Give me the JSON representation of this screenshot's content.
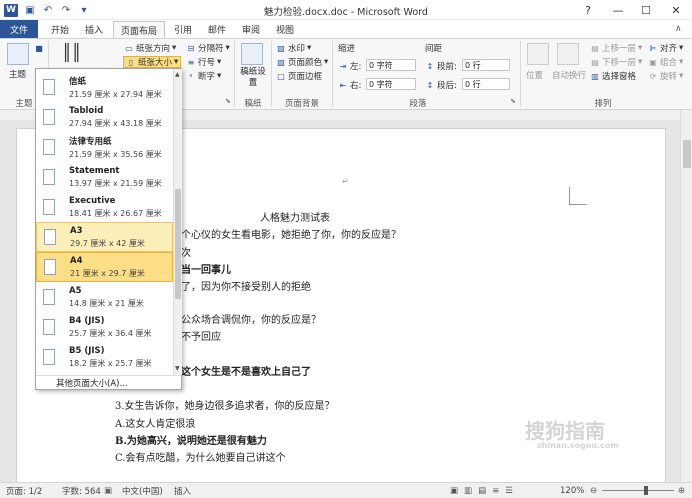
{
  "titlebar": {
    "title": "魅力检验.docx.doc - Microsoft Word",
    "logo": "W",
    "min": "—",
    "max": "☐",
    "close": "✕",
    "help_ico": "?"
  },
  "tabs": [
    "文件",
    "开始",
    "插入",
    "页面布局",
    "引用",
    "邮件",
    "审阅",
    "视图"
  ],
  "ribbon": {
    "theme": {
      "label": "主题",
      "group": "主题"
    },
    "page_setup": {
      "orientation": "纸张方向",
      "size": "纸张大小",
      "separator": "分隔符",
      "line_numbers": "行号",
      "hyphenation": "断字"
    },
    "draft": {
      "label": "稿纸设置",
      "group": "稿纸"
    },
    "background": {
      "watermark": "水印",
      "page_color": "页面颜色",
      "page_border": "页面边框",
      "group": "页面背景"
    },
    "paragraph": {
      "indent": "缩进",
      "spacing": "间距",
      "left_label": "左:",
      "left_value": "0 字符",
      "right_label": "右:",
      "right_value": "0 字符",
      "before_label": "段前:",
      "before_value": "0 行",
      "after_label": "段后:",
      "after_value": "0 行",
      "group": "段落"
    },
    "arrange": {
      "position": "位置",
      "wrap": "自动换行",
      "bring_forward": "上移一层",
      "send_backward": "下移一层",
      "selection_pane": "选择窗格",
      "align": "对齐",
      "group_btn": "组合",
      "rotate": "旋转",
      "group": "排列"
    }
  },
  "dropdown": {
    "items": [
      {
        "name": "信纸",
        "dims": "21.59 厘米 x 27.94 厘米"
      },
      {
        "name": "Tabloid",
        "dims": "27.94 厘米 x 43.18 厘米"
      },
      {
        "name": "法律专用纸",
        "dims": "21.59 厘米 x 35.56 厘米"
      },
      {
        "name": "Statement",
        "dims": "13.97 厘米 x 21.59 厘米"
      },
      {
        "name": "Executive",
        "dims": "18.41 厘米 x 26.67 厘米"
      },
      {
        "name": "A3",
        "dims": "29.7 厘米 x 42 厘米"
      },
      {
        "name": "A4",
        "dims": "21 厘米 x 29.7 厘米"
      },
      {
        "name": "A5",
        "dims": "14.8 厘米 x 21 厘米"
      },
      {
        "name": "B4 (JIS)",
        "dims": "25.7 厘米 x 36.4 厘米"
      },
      {
        "name": "B5 (JIS)",
        "dims": "18.2 厘米 x 25.7 厘米"
      }
    ],
    "footer": "其他页面大小(A)..."
  },
  "document": {
    "title": "人格魅力测试表",
    "lines": [
      {
        "text": "个心仪的女生看电影，她拒绝了你，你的反应是？",
        "bold": false
      },
      {
        "text": "次",
        "bold": false
      },
      {
        "text": "当一回事儿",
        "bold": true
      },
      {
        "text": "了，因为你不接受别人的拒绝",
        "bold": false
      },
      {
        "text": "公众场合调侃你，你的反应是？",
        "bold": false
      },
      {
        "text": "不予回应",
        "bold": false
      },
      {
        "text": "这个女生是不是喜欢上自己了",
        "bold": true
      },
      {
        "text": "3.女生告诉你，她身边很多追求者，你的反应是？",
        "bold": false
      },
      {
        "text": "A.这女人肯定很浪",
        "bold": false
      },
      {
        "text": "B.为她高兴，说明她还是很有魅力",
        "bold": true
      },
      {
        "text": "C.会有点吃醋，为什么她要自己讲这个",
        "bold": false
      }
    ],
    "watermark": "搜狗指南",
    "watermark_sub": "zhinan.sogou.com"
  },
  "status": {
    "page": "页面: 1/2",
    "words": "字数: 564",
    "lang": "中文(中国)",
    "mode": "插入",
    "zoom": "120%"
  }
}
